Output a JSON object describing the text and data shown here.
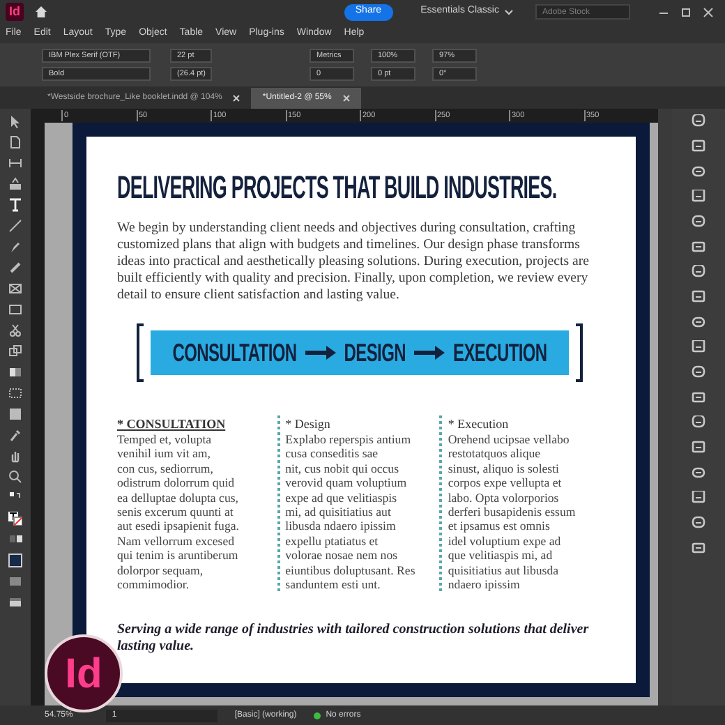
{
  "app_bar": {
    "logo": "Id",
    "share": "Share",
    "workspace": "Essentials Classic",
    "search": {
      "placeholder": "Adobe Stock"
    }
  },
  "menu": [
    "File",
    "Edit",
    "Layout",
    "Type",
    "Object",
    "Table",
    "View",
    "Plug-ins",
    "Window",
    "Help"
  ],
  "control_panel": {
    "row_1": [
      "IBM Plex Serif (OTF)",
      "22 pt",
      "Metrics",
      "100%",
      "97%"
    ],
    "row_2": [
      "Bold",
      "(26.4 pt)",
      "0",
      "0 pt",
      "0°"
    ]
  },
  "tabs": [
    {
      "label": "*Westside brochure_Like booklet.indd @ 104%",
      "selected": false
    },
    {
      "label": "*Untitled-2 @ 55%",
      "selected": true
    }
  ],
  "ruler": [
    "0",
    "50",
    "100",
    "150",
    "200",
    "250",
    "300",
    "350"
  ],
  "document": {
    "headline": "DELIVERING PROJECTS THAT BUILD INDUSTRIES.",
    "intro": "We begin by understanding client needs and objectives during consultation, crafting customized plans that align with budgets and timelines. Our design phase transforms ideas into practical and aesthetically pleasing solutions. During execution, projects are built efficiently with quality and precision. Finally, upon completion, we review every detail to ensure client satisfaction and lasting value.",
    "process": [
      "CONSULTATION",
      "DESIGN",
      "EXECUTION"
    ],
    "columns": [
      {
        "kind": "heading_bold",
        "heading": "* CONSULTATION",
        "body": "Temped et, volupta\nvenihil ium vit am,\ncon cus, sediorrum,\nodistrum dolorrum quid\nea delluptae dolupta cus,\nsenis excerum quunti at\naut esedi ipsapienit fuga.\nNam vellorrum excesed\nqui tenim is aruntiberum\ndolorpor sequam,\ncommimodior."
      },
      {
        "kind": "heading_plain",
        "heading": "* Design",
        "body": "Explabo reperspis antium\ncusa conseditis sae\nnit, cus nobit qui occus\nverovid quam voluptium\nexpe ad que velitiaspis\nmi, ad quisitiatius aut\nlibusda ndaero ipissim\nexpellu ptatiatus et\nvolorae nosae nem nos\neiuntibus doluptusant. Res\nsanduntem esti unt."
      },
      {
        "kind": "heading_plain",
        "heading": "* Execution",
        "body": "Orehend ucipsae vellabo\nrestotatquos alique\nsinust, aliquo is solesti\ncorpos expe vellupta et\nlabo. Opta volorporios\nderferi busapidenis essum\net ipsamus est omnis\nidel voluptium expe ad\nque velitiaspis mi, ad\nquisitiatius aut libusda\nndaero ipissim"
      }
    ],
    "tagline": "Serving a wide range of industries with tailored construction solutions that deliver lasting value."
  },
  "overlay_logo": "Id",
  "status_bar": {
    "zoom": "54.75%",
    "page": "1",
    "profile": "[Basic] (working)",
    "preflight": "No errors"
  }
}
